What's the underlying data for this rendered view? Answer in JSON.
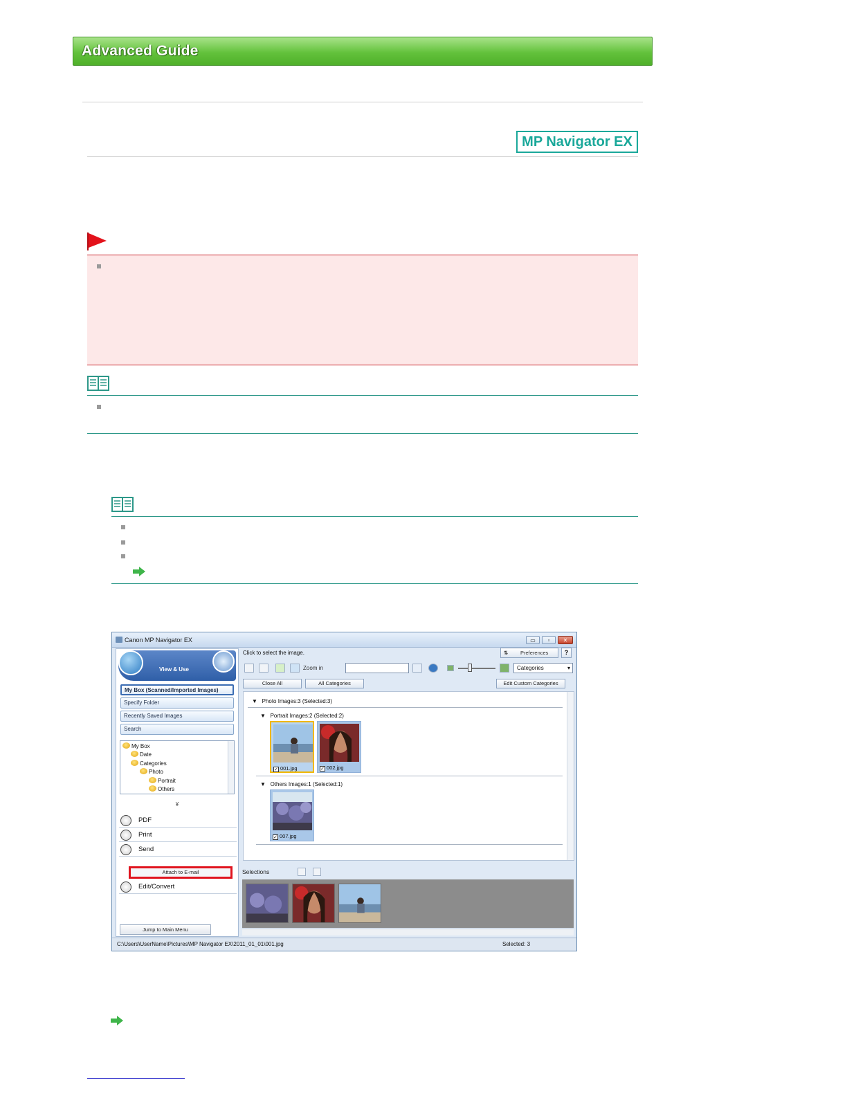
{
  "header": {
    "title": "Advanced Guide"
  },
  "badge": {
    "label": "MP Navigator EX"
  },
  "colors": {
    "banner": "#5fbf3a",
    "badge": "#1aa89a",
    "important_border": "#c8252b",
    "important_bg": "#fde8e8",
    "note_rule": "#2d9889",
    "highlight": "#e0141e"
  },
  "icons": {
    "important": "red-flag-icon",
    "note": "open-book-icon",
    "link": "green-arrow-icon"
  },
  "screenshot": {
    "window_title": "Canon MP Navigator EX",
    "window_buttons": [
      "▭",
      "▫",
      "✕"
    ],
    "view_use_label": "View & Use",
    "menu_items": [
      "My Box (Scanned/Imported Images)",
      "Specify Folder",
      "Recently Saved Images",
      "Search"
    ],
    "tree": [
      "My Box",
      "Date",
      "Categories",
      "Photo",
      "Portrait",
      "Others"
    ],
    "collapse_label": "¥",
    "actions": [
      "PDF",
      "Print",
      "Send",
      "Edit/Convert"
    ],
    "attach_label": "Attach to E-mail",
    "jump_label": "Jump to Main Menu",
    "hint": "Click to select the image.",
    "preferences_label": "Preferences",
    "help_label": "?",
    "zoom_label": "Zoom in",
    "category_select": "Categories",
    "buttons": {
      "close_all": "Close All",
      "all_categories": "All Categories",
      "edit_custom": "Edit Custom Categories"
    },
    "groups": {
      "photo": "Photo     Images:3     (Selected:3)",
      "portrait": "Portrait     Images:2     (Selected:2)",
      "others": "Others     Images:1     (Selected:1)"
    },
    "thumbs": [
      "001.jpg",
      "002.jpg",
      "007.jpg"
    ],
    "selections_label": "Selections",
    "status_path": "C:\\Users\\UserName\\Pictures\\MP Navigator EX\\2011_01_01\\001.jpg",
    "status_selected": "Selected: 3"
  }
}
